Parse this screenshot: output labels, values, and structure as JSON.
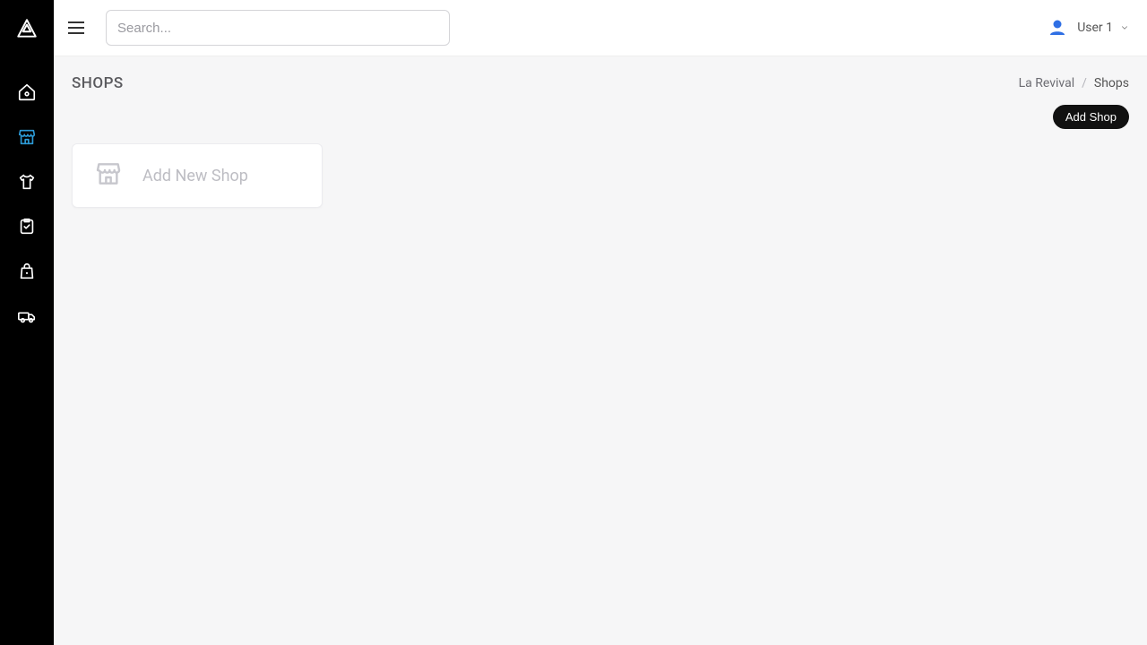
{
  "header": {
    "search_placeholder": "Search...",
    "user_label": "User 1"
  },
  "page": {
    "title": "SHOPS",
    "add_button": "Add Shop",
    "add_card_label": "Add New Shop"
  },
  "breadcrumb": {
    "root": "La Revival",
    "separator": "/",
    "current": "Shops"
  },
  "sidebar": {
    "items": [
      {
        "name": "home",
        "active": false
      },
      {
        "name": "shops",
        "active": true
      },
      {
        "name": "products",
        "active": false
      },
      {
        "name": "orders",
        "active": false
      },
      {
        "name": "bags",
        "active": false
      },
      {
        "name": "shipping",
        "active": false
      }
    ]
  },
  "colors": {
    "accent": "#2c9ad6",
    "avatar": "#2f6fe4",
    "btn_bg": "#111111"
  }
}
